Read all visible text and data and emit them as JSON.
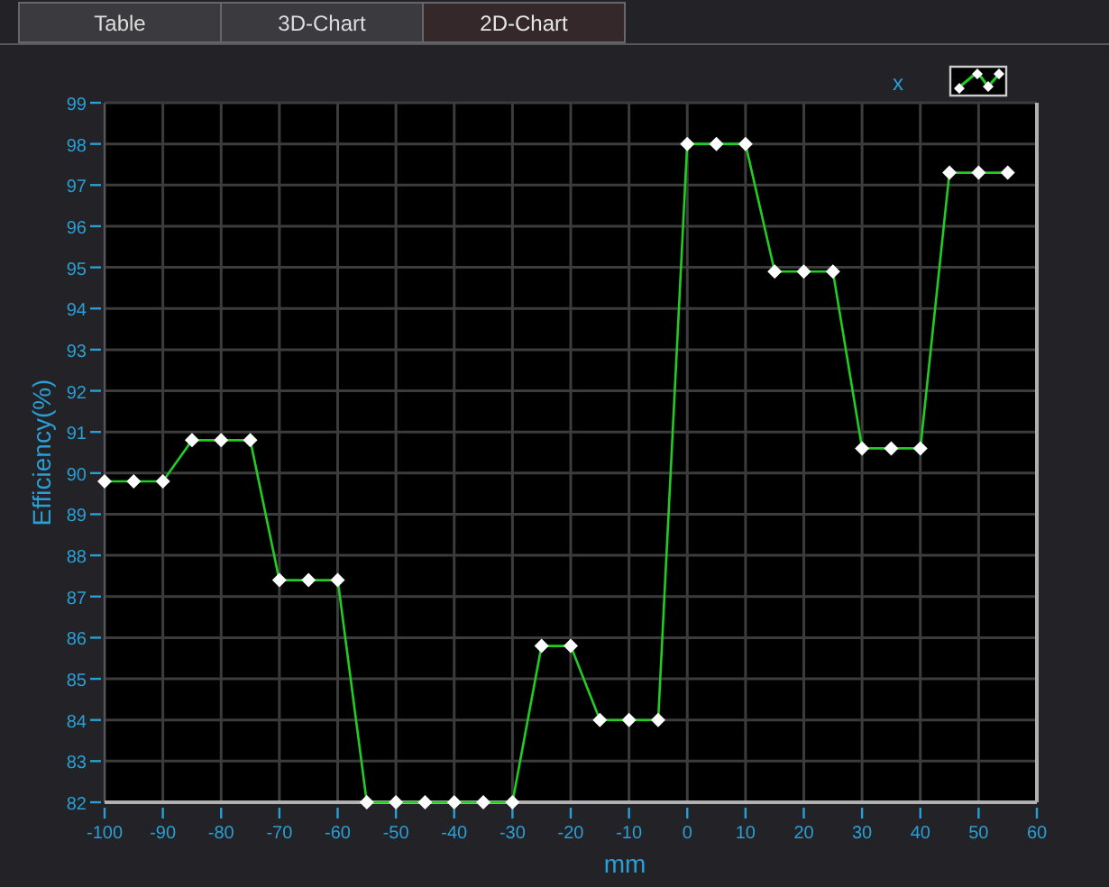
{
  "tabs": [
    {
      "label": "Table",
      "selected": false
    },
    {
      "label": "3D-Chart",
      "selected": false
    },
    {
      "label": "2D-Chart",
      "selected": true
    }
  ],
  "chart": {
    "chart_data": {
      "type": "line",
      "xlabel": "mm",
      "ylabel": "Efficiency(%)",
      "x": [
        -100,
        -95,
        -90,
        -85,
        -80,
        -75,
        -70,
        -65,
        -60,
        -55,
        -50,
        -45,
        -40,
        -35,
        -30,
        -25,
        -20,
        -15,
        -10,
        -5,
        0,
        5,
        10,
        15,
        20,
        25,
        30,
        35,
        40,
        45,
        50,
        55
      ],
      "grid": true,
      "series": [
        {
          "name": "x",
          "color": "#22cc22",
          "marker": "diamond",
          "values": [
            89.8,
            89.8,
            89.8,
            90.8,
            90.8,
            90.8,
            87.4,
            87.4,
            87.4,
            82.0,
            82.0,
            82.0,
            82.0,
            82.0,
            82.0,
            85.8,
            85.8,
            84.0,
            84.0,
            84.0,
            98.0,
            98.0,
            98.0,
            94.9,
            94.9,
            94.9,
            90.6,
            90.6,
            90.6,
            97.3,
            97.3,
            97.3
          ]
        }
      ],
      "xlim": [
        -100,
        60
      ],
      "ylim": [
        82,
        99
      ],
      "xticks": [
        -100,
        -90,
        -80,
        -70,
        -60,
        -50,
        -40,
        -30,
        -20,
        -10,
        0,
        10,
        20,
        30,
        40,
        50,
        60
      ],
      "yticks": [
        82,
        83,
        84,
        85,
        86,
        87,
        88,
        89,
        90,
        91,
        92,
        93,
        94,
        95,
        96,
        97,
        98,
        99
      ]
    }
  }
}
